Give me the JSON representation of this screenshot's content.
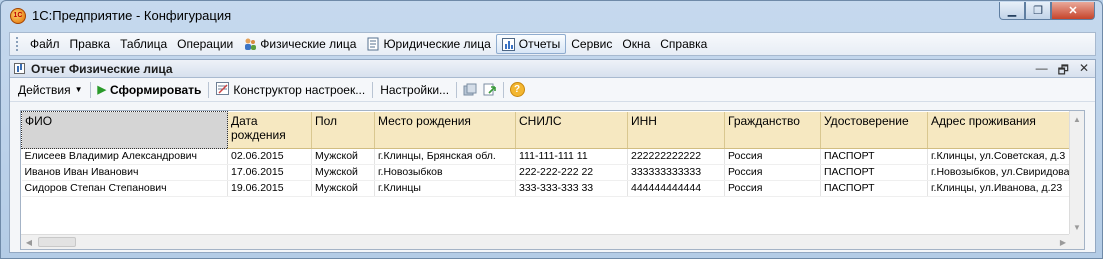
{
  "window": {
    "icon_text": "1С",
    "title": "1С:Предприятие - Конфигурация",
    "minimize": "▁",
    "restore": "❐",
    "close": "✕"
  },
  "menu": [
    {
      "label": "Файл",
      "icon": ""
    },
    {
      "label": "Правка",
      "icon": ""
    },
    {
      "label": "Таблица",
      "icon": ""
    },
    {
      "label": "Операции",
      "icon": ""
    },
    {
      "label": "Физические лица",
      "icon": "people-icon"
    },
    {
      "label": "Юридические лица",
      "icon": "document-icon"
    },
    {
      "label": "Отчеты",
      "icon": "report-icon"
    },
    {
      "label": "Сервис",
      "icon": ""
    },
    {
      "label": "Окна",
      "icon": ""
    },
    {
      "label": "Справка",
      "icon": ""
    }
  ],
  "document": {
    "title": "Отчет  Физические лица",
    "minimize": "—",
    "restore": "🗗",
    "close": "✕"
  },
  "toolbar": {
    "actions": "Действия",
    "generate": "Сформировать",
    "constructor": "Конструктор настроек...",
    "settings": "Настройки...",
    "help": "?"
  },
  "table": {
    "columns": [
      "ФИО",
      "Дата рождения",
      "Пол",
      "Место рождения",
      "СНИЛС",
      "ИНН",
      "Гражданство",
      "Удостоверение",
      "Адрес проживания"
    ],
    "rows": [
      [
        "Елисеев Владимир Александрович",
        "02.06.2015",
        "Мужской",
        "г.Клинцы, Брянская обл.",
        "111-111-111 11",
        "222222222222",
        "Россия",
        "ПАСПОРТ",
        "г.Клинцы, ул.Советская, д.3"
      ],
      [
        "Иванов Иван Иванович",
        "17.06.2015",
        "Мужской",
        "г.Новозыбков",
        "222-222-222 22",
        "333333333333",
        "Россия",
        "ПАСПОРТ",
        "г.Новозыбков, ул.Свиридова"
      ],
      [
        "Сидоров Степан Степанович",
        "19.06.2015",
        "Мужской",
        "г.Клинцы",
        "333-333-333 33",
        "444444444444",
        "Россия",
        "ПАСПОРТ",
        "г.Клинцы, ул.Иванова, д.23"
      ]
    ]
  },
  "colors": {
    "header_bg": "#f6e8c1",
    "frame": "#b9d1ea",
    "active_menu": "#d8e6f6"
  }
}
